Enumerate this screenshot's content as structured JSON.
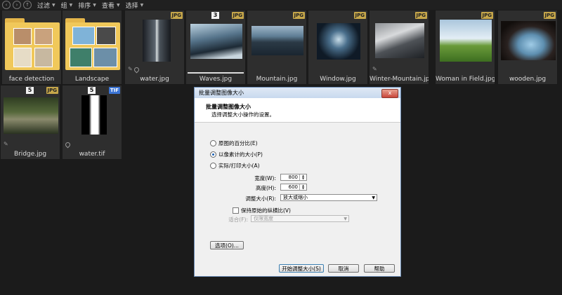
{
  "toolbar": {
    "nav_icons": [
      "back-icon",
      "forward-icon",
      "up-icon"
    ],
    "menus": [
      "过滤",
      "组",
      "排序",
      "查看",
      "选择"
    ]
  },
  "grid": {
    "items": [
      {
        "name": "face detection",
        "kind": "folder"
      },
      {
        "name": "Landscape",
        "kind": "folder"
      },
      {
        "name": "water.jpg",
        "type": "JPG"
      },
      {
        "name": "Waves.jpg",
        "type": "JPG",
        "rating": "3"
      },
      {
        "name": "Mountain.jpg",
        "type": "JPG"
      },
      {
        "name": "Window.jpg",
        "type": "JPG"
      },
      {
        "name": "Winter-Mountain.jpg",
        "type": "JPG"
      },
      {
        "name": "Woman in Field.jpg",
        "type": "JPG"
      },
      {
        "name": "wooden.jpg",
        "type": "JPG"
      },
      {
        "name": "Bridge.jpg",
        "type": "JPG",
        "rating": "5"
      },
      {
        "name": "water.tif",
        "type": "TIF",
        "rating": "5"
      }
    ]
  },
  "dialog": {
    "title": "批量调整图像大小",
    "close": "x",
    "heading": "批量调整图像大小",
    "subheading": "选择调整大小操作的设置。",
    "options": {
      "percent": "原图的百分比(E)",
      "pixels": "以像素计的大小(P)",
      "print": "实际/打印大小(A)"
    },
    "width_label": "宽度(W):",
    "width_value": "800",
    "height_label": "高度(H):",
    "height_value": "600",
    "resize_label": "调整大小(R):",
    "resize_value": "放大或缩小",
    "keep_ratio": "保持原始的纵横比(V)",
    "fit_label": "适合(F):",
    "fit_value": "仅限宽度",
    "options_button": "选项(O)...",
    "start_button": "开始调整大小(S)",
    "cancel_button": "取消",
    "help_button": "帮助"
  },
  "colors": {
    "background": "#1b1b1b",
    "cell": "#2e2e2e",
    "jpg_badge": "#c5a64a",
    "tif_badge": "#3b74d4",
    "folder": "#f0c85a"
  }
}
